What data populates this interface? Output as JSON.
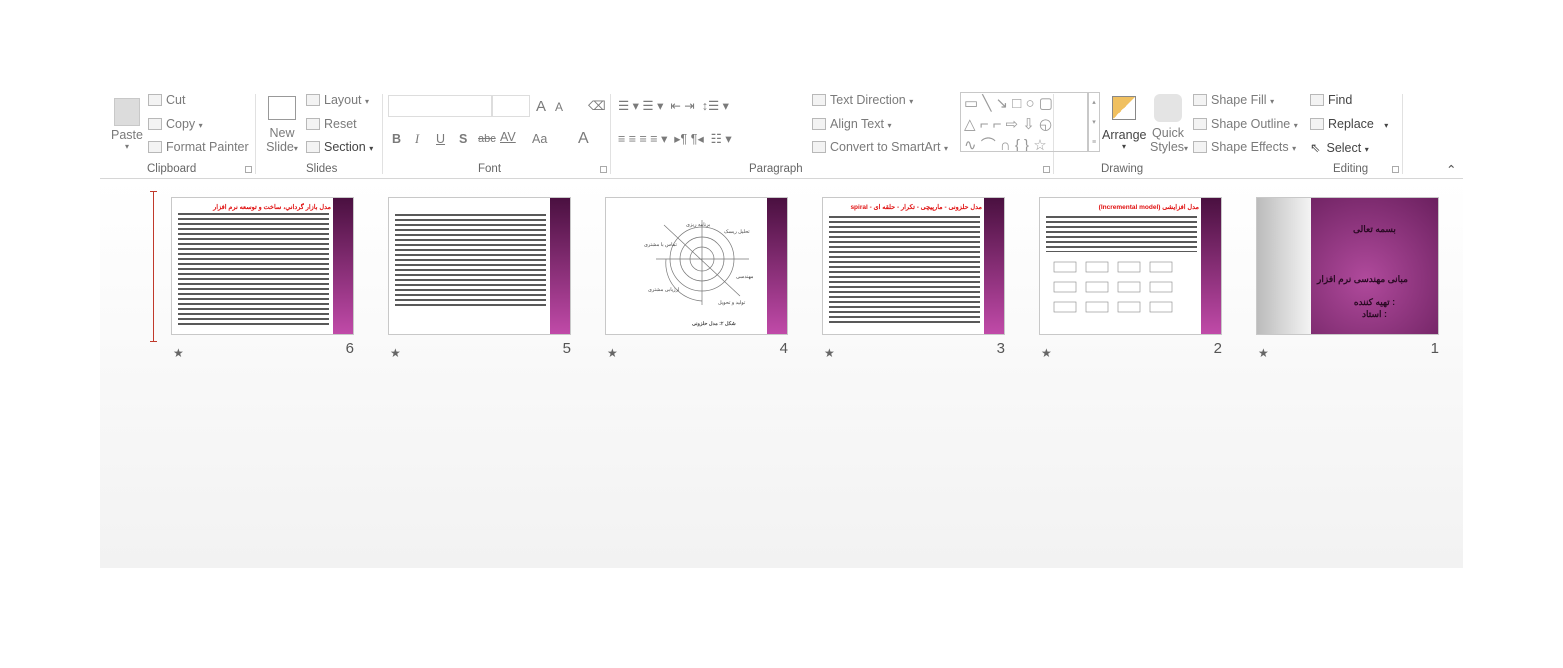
{
  "ribbon": {
    "clipboard": {
      "paste": "Paste",
      "cut": "Cut",
      "copy": "Copy",
      "format_painter": "Format Painter",
      "label": "Clipboard"
    },
    "slides": {
      "new_slide_1": "New",
      "new_slide_2": "Slide",
      "layout": "Layout",
      "reset": "Reset",
      "section": "Section",
      "label": "Slides"
    },
    "font": {
      "bold": "B",
      "italic": "I",
      "underline": "U",
      "shadow": "S",
      "strike": "abc",
      "spacing": "AV",
      "case": "Aa",
      "color": "A",
      "grow": "A",
      "shrink": "A",
      "label": "Font"
    },
    "paragraph": {
      "text_direction": "Text Direction",
      "align_text": "Align Text",
      "convert_smartart": "Convert to SmartArt",
      "label": "Paragraph"
    },
    "drawing": {
      "arrange": "Arrange",
      "quick_styles_1": "Quick",
      "quick_styles_2": "Styles",
      "shape_fill": "Shape Fill",
      "shape_outline": "Shape Outline",
      "shape_effects": "Shape Effects",
      "label": "Drawing"
    },
    "editing": {
      "find": "Find",
      "replace": "Replace",
      "select": "Select",
      "label": "Editing"
    }
  },
  "slides": [
    {
      "number": "1",
      "line1": "بسمه تعالی",
      "line2": "مبانی مهندسی نرم افزار",
      "line3": "تهیه کننده :",
      "line4": "استاد :"
    },
    {
      "number": "2",
      "title": "مدل افزایشی (Incremental model)"
    },
    {
      "number": "3",
      "title": "مدل حلزونی - مارپیچی - تکرار - حلقه ای - spiral"
    },
    {
      "number": "4",
      "diagram_labels": [
        "برنامه ریزی",
        "تحلیل ریسک",
        "تماس با مشتری",
        "مهندسی",
        "ارزیابی مشتری",
        "تولید و تحویل"
      ],
      "caption": "شکل ۲: مدل حلزونی"
    },
    {
      "number": "5"
    },
    {
      "number": "6",
      "title": "مدل بازار گرداني، ساخت و توسعه نرم افزار",
      "selected": true
    }
  ],
  "colors": {
    "accent_purple": "#8a2a78",
    "title_red": "#e01010",
    "insertion_marker": "#c0392b"
  }
}
